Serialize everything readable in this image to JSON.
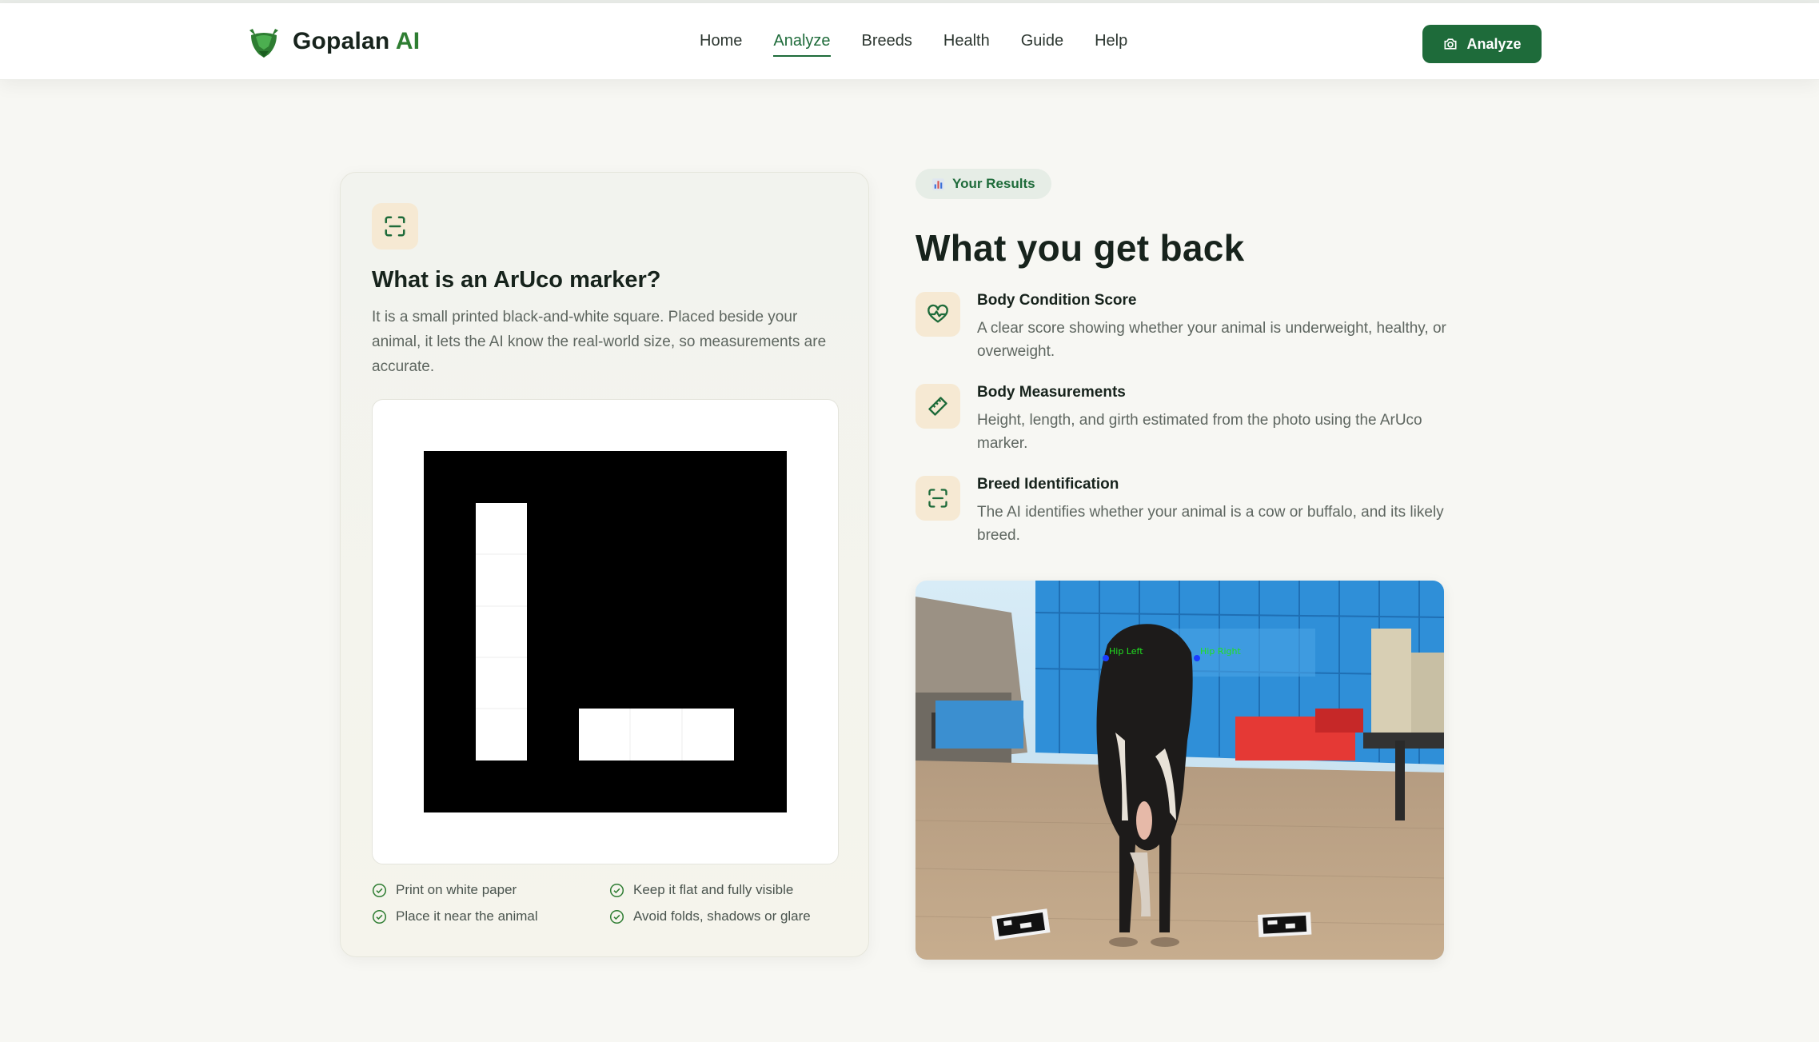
{
  "brand": {
    "name": "Gopalan",
    "accent": "AI",
    "logo_icon": "cow-head-icon"
  },
  "nav": {
    "items": [
      {
        "label": "Home",
        "active": false
      },
      {
        "label": "Analyze",
        "active": true
      },
      {
        "label": "Breeds",
        "active": false
      },
      {
        "label": "Health",
        "active": false
      },
      {
        "label": "Guide",
        "active": false
      },
      {
        "label": "Help",
        "active": false
      }
    ],
    "cta_label": "Analyze",
    "cta_icon": "camera-icon"
  },
  "aruco_card": {
    "icon": "scan-icon",
    "title": "What is an ArUco marker?",
    "description": "It is a small printed black-and-white square. Placed beside your animal, it lets the AI know the real-world size, so measurements are accurate.",
    "tips": [
      "Print on white paper",
      "Keep it flat and fully visible",
      "Place it near the animal",
      "Avoid folds, shadows or glare"
    ],
    "tip_icon": "check-circle-icon"
  },
  "results": {
    "badge_icon": "bar-chart-icon",
    "badge": "Your Results",
    "title": "What you get back",
    "features": [
      {
        "icon": "heart-pulse-icon",
        "title": "Body Condition Score",
        "description": "A clear score showing whether your animal is underweight, healthy, or overweight."
      },
      {
        "icon": "ruler-icon",
        "title": "Body Measurements",
        "description": "Height, length, and girth estimated from the photo using the ArUco marker."
      },
      {
        "icon": "scan-icon",
        "title": "Breed Identification",
        "description": "The AI identifies whether your animal is a cow or buffalo, and its likely breed."
      }
    ],
    "photo_labels": {
      "left": "Hip Left",
      "right": "Hip Right"
    }
  },
  "colors": {
    "primary": "#1e6b3a",
    "accent_bg": "#f6e9d3",
    "page_bg": "#f7f7f3"
  }
}
